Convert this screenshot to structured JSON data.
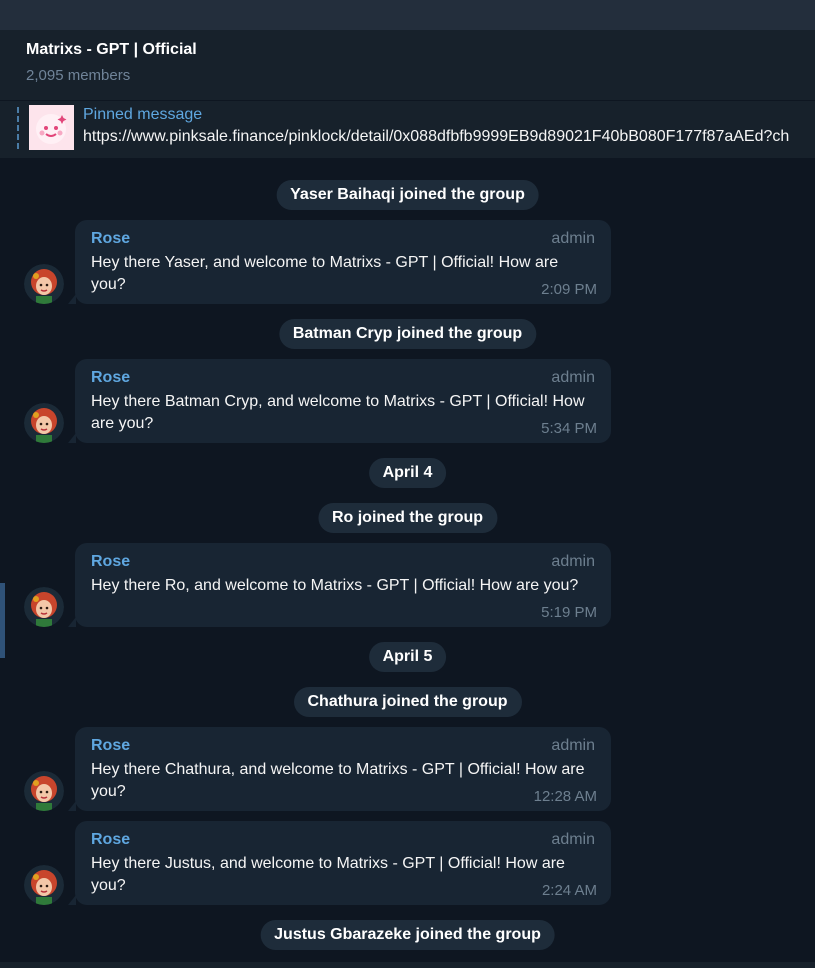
{
  "chat": {
    "title": "Matrixs - GPT | Official",
    "subtitle": "2,095 members"
  },
  "pinned": {
    "label": "Pinned message",
    "text": "https://www.pinksale.finance/pinklock/detail/0x088dfbfb9999EB9d89021F40bB080F177f87aAEd?ch"
  },
  "feed": [
    {
      "kind": "service",
      "text": "Yaser Baihaqi joined the group"
    },
    {
      "kind": "message",
      "sender": "Rose",
      "role": "admin",
      "body": "Hey there Yaser, and welcome to Matrixs - GPT | Official! How are you?",
      "time": "2:09 PM"
    },
    {
      "kind": "service",
      "text": "Batman Cryp joined the group"
    },
    {
      "kind": "message",
      "sender": "Rose",
      "role": "admin",
      "body": "Hey there Batman Cryp, and welcome to Matrixs - GPT | Official! How are you?",
      "time": "5:34 PM"
    },
    {
      "kind": "service",
      "text": "April 4"
    },
    {
      "kind": "service",
      "text": "Ro joined the group"
    },
    {
      "kind": "message",
      "sender": "Rose",
      "role": "admin",
      "body": "Hey there Ro, and welcome to Matrixs - GPT | Official! How are you?",
      "time": "5:19 PM"
    },
    {
      "kind": "service",
      "text": "April 5"
    },
    {
      "kind": "service",
      "text": "Chathura joined the group"
    },
    {
      "kind": "message",
      "sender": "Rose",
      "role": "admin",
      "body": "Hey there Chathura, and welcome to Matrixs - GPT | Official! How are you?",
      "time": "12:28 AM"
    },
    {
      "kind": "message",
      "sender": "Rose",
      "role": "admin",
      "body": "Hey there Justus, and welcome to Matrixs - GPT | Official! How are you?",
      "time": "2:24 AM"
    },
    {
      "kind": "service",
      "text": "Justus Gbarazeke joined the group"
    }
  ],
  "colors": {
    "background": "#0e1621",
    "bubble": "#182533",
    "accent": "#5fa7e0",
    "muted": "#6d7f8f"
  },
  "icons": {
    "pinned_thumb": "pink-smiley-icon",
    "avatar": "rose-avatar-icon"
  }
}
